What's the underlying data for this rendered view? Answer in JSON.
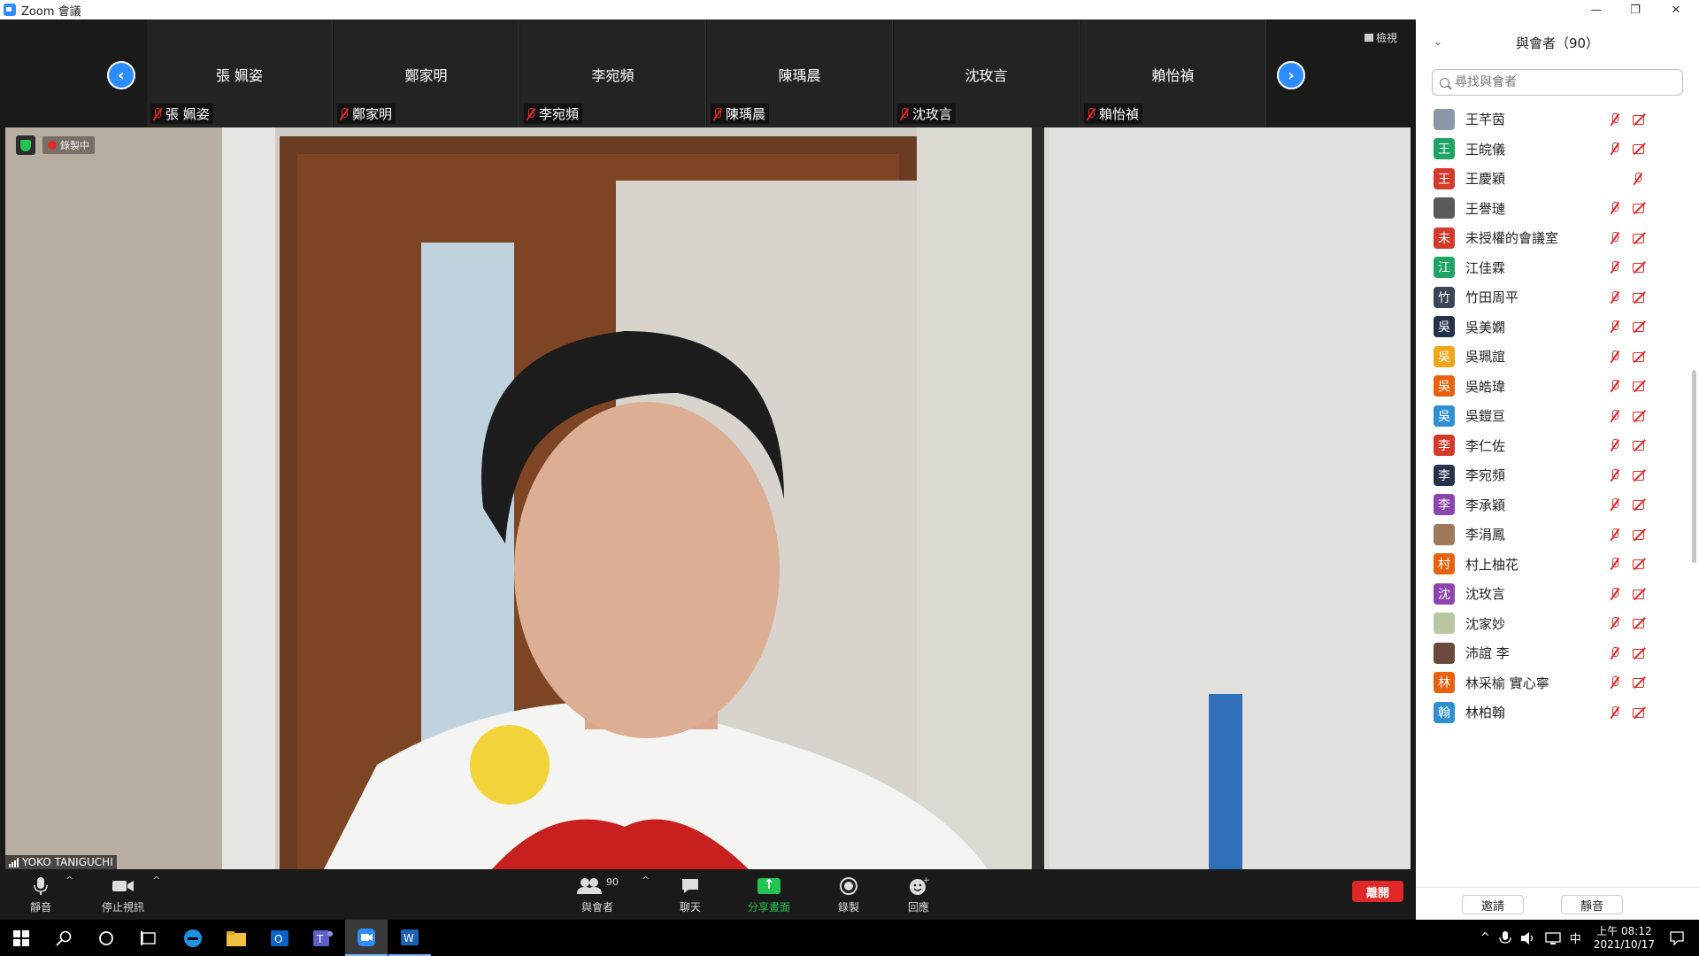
{
  "window": {
    "title": "Zoom 會議"
  },
  "strip": {
    "view_label": "檢視",
    "prev_arrow": "‹",
    "next_arrow": "›",
    "tiles": [
      {
        "name": "張 姵姿",
        "label": "張 姵姿"
      },
      {
        "name": "鄭家明",
        "label": "鄭家明"
      },
      {
        "name": "李宛頻",
        "label": "李宛頻"
      },
      {
        "name": "陳瑀晨",
        "label": "陳瑀晨"
      },
      {
        "name": "沈玫言",
        "label": "沈玫言"
      },
      {
        "name": "賴怡禎",
        "label": "賴怡禎"
      }
    ]
  },
  "video": {
    "recording_label": "錄製中",
    "speaker_name": "YOKO TANIGUCHI"
  },
  "toolbar": {
    "mute": "靜音",
    "stop_video": "停止視訊",
    "participants": "與會者",
    "participants_count": "90",
    "chat": "聊天",
    "share": "分享畫面",
    "record": "錄製",
    "reactions": "回應",
    "leave": "離開",
    "caret": "^"
  },
  "panel": {
    "title": "與會者（90）",
    "chevron": "⌄",
    "search_placeholder": "尋找與會者",
    "participants": [
      {
        "name": "王芊茵",
        "avatar": "photo",
        "color": "#8a97a8",
        "cam": true
      },
      {
        "name": "王皖儀",
        "avatar": "王",
        "color": "#1fa463",
        "cam": true
      },
      {
        "name": "王慶穎",
        "avatar": "王",
        "color": "#d33a2c",
        "cam": false
      },
      {
        "name": "王譽璉",
        "avatar": "photo",
        "color": "#5a5a5a",
        "cam": true
      },
      {
        "name": "未授權的會議室",
        "avatar": "未",
        "color": "#d33a2c",
        "cam": true
      },
      {
        "name": "江佳霖",
        "avatar": "江",
        "color": "#1fa463",
        "cam": true
      },
      {
        "name": "竹田周平",
        "avatar": "竹",
        "color": "#3a4556",
        "cam": true
      },
      {
        "name": "吳美嫻",
        "avatar": "吳",
        "color": "#24324a",
        "cam": true
      },
      {
        "name": "吳珮誼",
        "avatar": "吳",
        "color": "#f2a516",
        "cam": true
      },
      {
        "name": "吳皓瑋",
        "avatar": "吳",
        "color": "#e8620e",
        "cam": true
      },
      {
        "name": "吳鎧亘",
        "avatar": "吳",
        "color": "#2f8fd0",
        "cam": true
      },
      {
        "name": "李仁佐",
        "avatar": "李",
        "color": "#d33a2c",
        "cam": true
      },
      {
        "name": "李宛頻",
        "avatar": "李",
        "color": "#24324a",
        "cam": true
      },
      {
        "name": "李承穎",
        "avatar": "李",
        "color": "#8e44ad",
        "cam": true
      },
      {
        "name": "李涓鳳",
        "avatar": "photo",
        "color": "#a0785a",
        "cam": true
      },
      {
        "name": "村上柚花",
        "avatar": "村",
        "color": "#e8620e",
        "cam": true
      },
      {
        "name": "沈玫言",
        "avatar": "沈",
        "color": "#8e44ad",
        "cam": true
      },
      {
        "name": "沈家妙",
        "avatar": "photo",
        "color": "#b9c7a0",
        "cam": true
      },
      {
        "name": "沛誼 李",
        "avatar": "photo",
        "color": "#6a4a3a",
        "cam": true
      },
      {
        "name": "林采榆 實心寧",
        "avatar": "林",
        "color": "#e8620e",
        "cam": true
      },
      {
        "name": "林柏翰",
        "avatar": "翰",
        "color": "#2f8fd0",
        "cam": true
      }
    ],
    "invite": "邀請",
    "mute_all": "靜音"
  },
  "taskbar": {
    "time": "上午 08:12",
    "date": "2021/10/17",
    "ime": "中"
  }
}
